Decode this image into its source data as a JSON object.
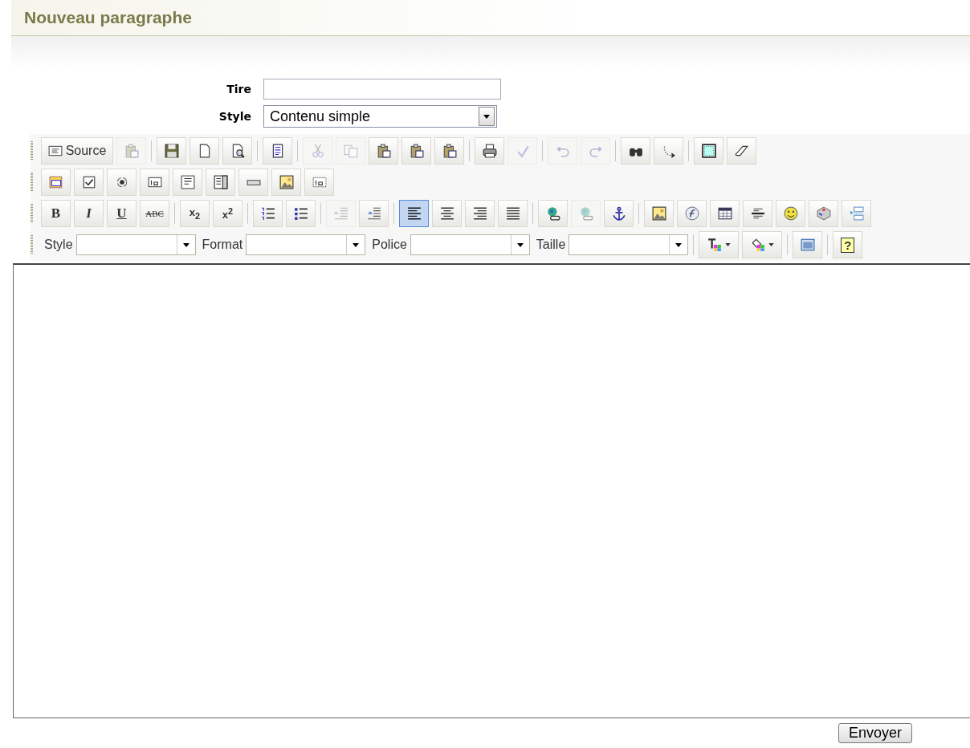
{
  "page_title": "Nouveau paragraphe",
  "title_field": {
    "label": "Tire"
  },
  "style_field": {
    "label": "Style",
    "value": "Contenu simple"
  },
  "toolbar": {
    "rows": [
      [
        [
          {
            "kind": "text",
            "label": "Source",
            "disabled": false
          },
          {
            "kind": "icon",
            "disabled": true
          }
        ],
        [
          {
            "kind": "icon",
            "disabled": false
          },
          {
            "kind": "icon",
            "disabled": false
          },
          {
            "kind": "icon",
            "disabled": false
          }
        ],
        [
          {
            "kind": "icon",
            "disabled": false
          }
        ],
        [
          {
            "kind": "icon",
            "disabled": true
          },
          {
            "kind": "icon",
            "disabled": true
          },
          {
            "kind": "icon",
            "disabled": false
          },
          {
            "kind": "icon",
            "disabled": false
          },
          {
            "kind": "icon",
            "disabled": false
          }
        ],
        [
          {
            "kind": "icon",
            "disabled": false
          },
          {
            "kind": "icon",
            "disabled": true
          }
        ],
        [
          {
            "kind": "icon",
            "disabled": true
          },
          {
            "kind": "icon",
            "disabled": true
          }
        ],
        [
          {
            "kind": "icon",
            "disabled": false
          },
          {
            "kind": "icon",
            "disabled": false
          }
        ],
        [
          {
            "kind": "icon",
            "disabled": false
          },
          {
            "kind": "icon",
            "disabled": false
          }
        ]
      ],
      [
        [
          {
            "kind": "icon",
            "disabled": false
          },
          {
            "kind": "icon",
            "disabled": false
          },
          {
            "kind": "icon",
            "disabled": false
          },
          {
            "kind": "icon",
            "disabled": false
          },
          {
            "kind": "icon",
            "disabled": false
          },
          {
            "kind": "icon",
            "disabled": false
          },
          {
            "kind": "icon",
            "disabled": false
          },
          {
            "kind": "icon",
            "disabled": false
          },
          {
            "kind": "icon",
            "disabled": false
          }
        ]
      ],
      [
        [
          {
            "kind": "glyph",
            "label": "B",
            "disabled": false
          },
          {
            "kind": "glyph",
            "label": "I",
            "disabled": false
          },
          {
            "kind": "glyph",
            "label": "U",
            "disabled": false
          },
          {
            "kind": "glyph",
            "label": "ABC",
            "disabled": false
          }
        ],
        [
          {
            "kind": "glyph",
            "label": "x$_{2}$",
            "disabled": false
          },
          {
            "kind": "glyph",
            "label": "x$^{2}$",
            "disabled": false
          }
        ],
        [
          {
            "kind": "icon",
            "disabled": false
          },
          {
            "kind": "icon",
            "disabled": false
          }
        ],
        [
          {
            "kind": "icon",
            "disabled": true
          },
          {
            "kind": "icon",
            "disabled": false
          }
        ],
        [
          {
            "kind": "icon",
            "disabled": false,
            "selected": true
          },
          {
            "kind": "icon",
            "disabled": false,
            "selected": false
          },
          {
            "kind": "icon",
            "disabled": false,
            "selected": false
          },
          {
            "kind": "icon",
            "disabled": false,
            "selected": false
          }
        ],
        [
          {
            "kind": "icon",
            "disabled": false
          },
          {
            "kind": "icon",
            "disabled": true
          },
          {
            "kind": "icon",
            "disabled": false
          }
        ],
        [
          {
            "kind": "icon",
            "disabled": false
          },
          {
            "kind": "icon",
            "disabled": false
          },
          {
            "kind": "icon",
            "disabled": false
          },
          {
            "kind": "icon",
            "disabled": false
          },
          {
            "kind": "icon",
            "disabled": false
          },
          {
            "kind": "icon",
            "disabled": false
          },
          {
            "kind": "icon",
            "disabled": false
          }
        ]
      ],
      [
        [
          {
            "kind": "combo",
            "label": "Style"
          },
          {
            "kind": "combo",
            "label": "Format"
          },
          {
            "kind": "combo",
            "label": "Police"
          },
          {
            "kind": "combo",
            "label": "Taille"
          }
        ],
        [
          {
            "kind": "dropdown",
            "disabled": false
          },
          {
            "kind": "dropdown",
            "disabled": false
          }
        ],
        [
          {
            "kind": "icon",
            "disabled": false
          }
        ],
        [
          {
            "kind": "glyph",
            "label": "?",
            "disabled": false
          }
        ]
      ]
    ]
  },
  "submit": {
    "label": "Envoyer"
  }
}
